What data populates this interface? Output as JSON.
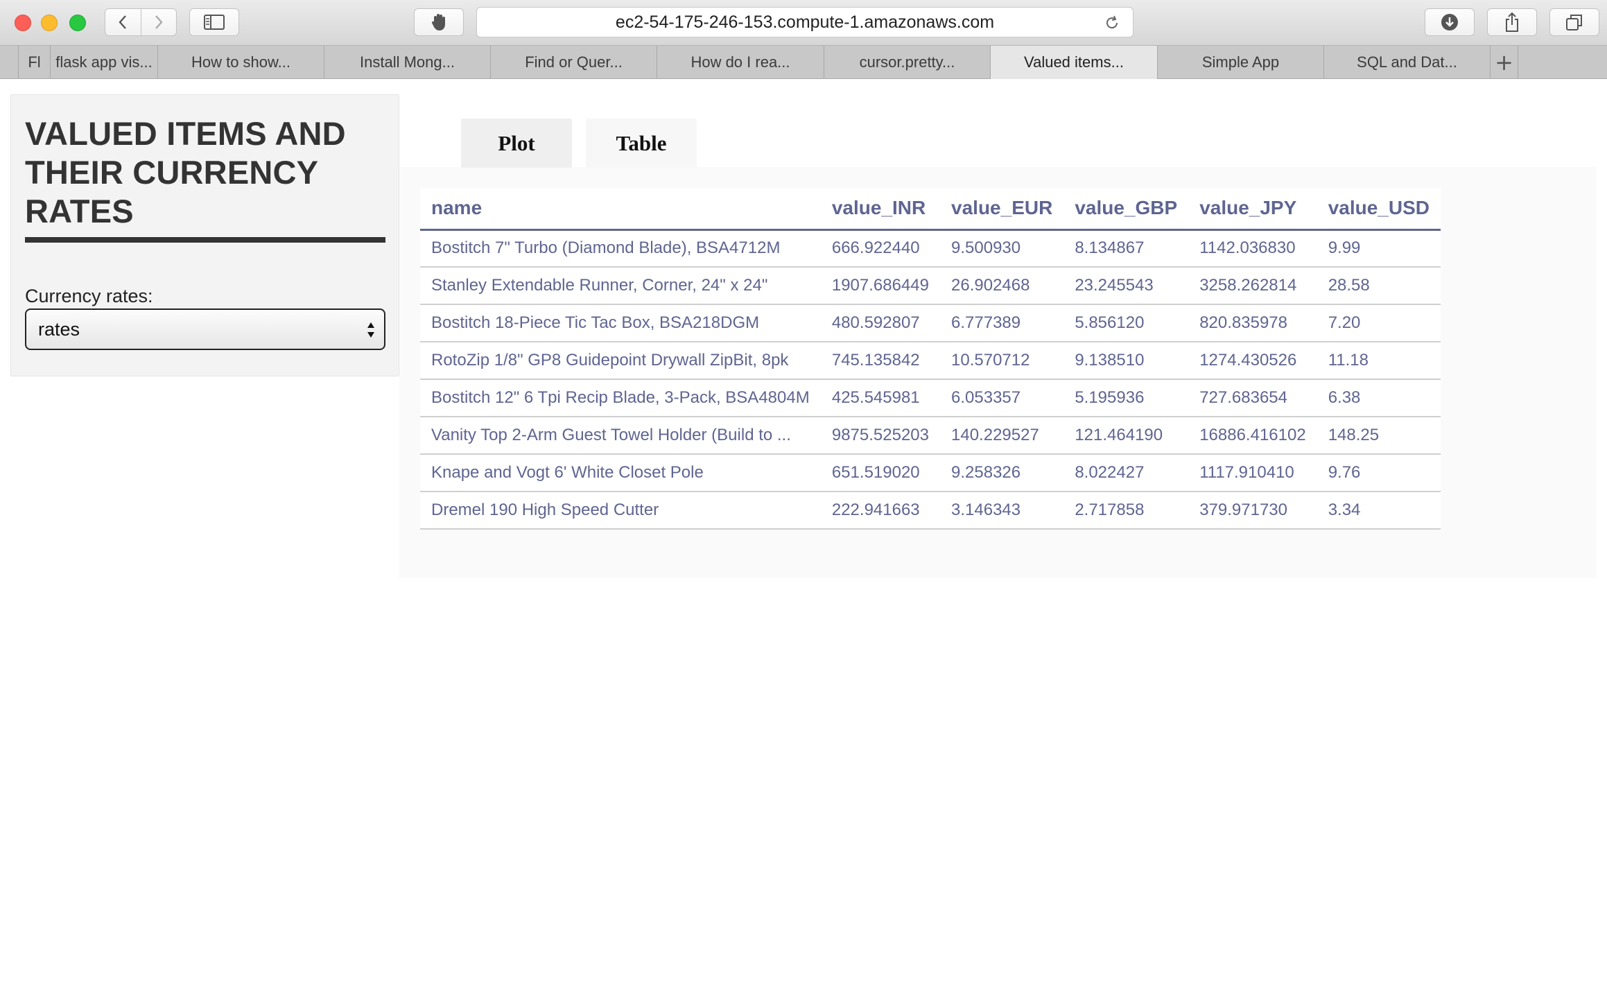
{
  "browser": {
    "url": "ec2-54-175-246-153.compute-1.amazonaws.com",
    "tabs": [
      {
        "label": "Fl",
        "active": false
      },
      {
        "label": "flask app vis...",
        "active": false
      },
      {
        "label": "How to show...",
        "active": false
      },
      {
        "label": "Install Mong...",
        "active": false
      },
      {
        "label": "Find or Quer...",
        "active": false
      },
      {
        "label": "How do I rea...",
        "active": false
      },
      {
        "label": "cursor.pretty...",
        "active": false
      },
      {
        "label": "Valued items...",
        "active": true
      },
      {
        "label": "Simple App",
        "active": false
      },
      {
        "label": "SQL and Dat...",
        "active": false
      }
    ],
    "new_tab_label": "+"
  },
  "sidebar": {
    "title": "VALUED ITEMS AND THEIR CURRENCY RATES",
    "select_label": "Currency rates:",
    "select_value": "rates"
  },
  "main": {
    "tabs": [
      {
        "label": "Plot",
        "active": false
      },
      {
        "label": "Table",
        "active": true
      }
    ],
    "table": {
      "columns": [
        "name",
        "value_INR",
        "value_EUR",
        "value_GBP",
        "value_JPY",
        "value_USD"
      ],
      "rows": [
        [
          "Bostitch 7\" Turbo (Diamond Blade), BSA4712M",
          "666.922440",
          "9.500930",
          "8.134867",
          "1142.036830",
          "9.99"
        ],
        [
          "Stanley Extendable Runner, Corner, 24\" x 24\"",
          "1907.686449",
          "26.902468",
          "23.245543",
          "3258.262814",
          "28.58"
        ],
        [
          "Bostitch 18-Piece Tic Tac Box, BSA218DGM",
          "480.592807",
          "6.777389",
          "5.856120",
          "820.835978",
          "7.20"
        ],
        [
          "RotoZip 1/8\" GP8 Guidepoint Drywall ZipBit, 8pk",
          "745.135842",
          "10.570712",
          "9.138510",
          "1274.430526",
          "11.18"
        ],
        [
          "Bostitch 12\" 6 Tpi Recip Blade, 3-Pack, BSA4804M",
          "425.545981",
          "6.053357",
          "5.195936",
          "727.683654",
          "6.38"
        ],
        [
          "Vanity Top 2-Arm Guest Towel Holder (Build to ...",
          "9875.525203",
          "140.229527",
          "121.464190",
          "16886.416102",
          "148.25"
        ],
        [
          "Knape and Vogt 6' White Closet Pole",
          "651.519020",
          "9.258326",
          "8.022427",
          "1117.910410",
          "9.76"
        ],
        [
          "Dremel 190 High Speed Cutter",
          "222.941663",
          "3.146343",
          "2.717858",
          "379.971730",
          "3.34"
        ]
      ]
    }
  },
  "colors": {
    "table_text": "#5f6591",
    "sidebar_bg": "#f3f3f3",
    "title_text": "#333333"
  }
}
